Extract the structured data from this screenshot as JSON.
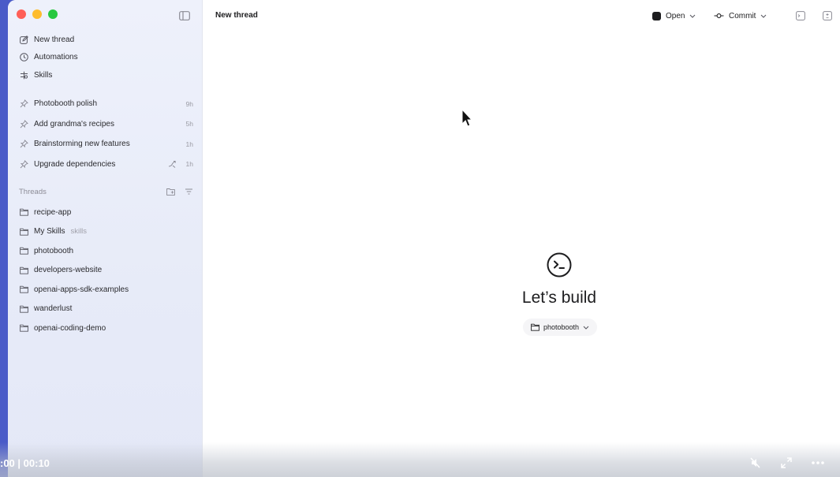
{
  "window": {
    "title": "New thread"
  },
  "sidebar": {
    "nav": [
      {
        "label": "New thread",
        "icon": "edit-icon"
      },
      {
        "label": "Automations",
        "icon": "clock-icon"
      },
      {
        "label": "Skills",
        "icon": "skills-icon"
      }
    ],
    "pinned": [
      {
        "label": "Photobooth polish",
        "time": "9h"
      },
      {
        "label": "Add grandma's recipes",
        "time": "5h"
      },
      {
        "label": "Brainstorming new features",
        "time": "1h"
      },
      {
        "label": "Upgrade dependencies",
        "time": "1h"
      }
    ],
    "threads_heading": "Threads",
    "threads": [
      {
        "label": "recipe-app",
        "sub": ""
      },
      {
        "label": "My Skills",
        "sub": "skills"
      },
      {
        "label": "photobooth",
        "sub": ""
      },
      {
        "label": "developers-website",
        "sub": ""
      },
      {
        "label": "openai-apps-sdk-examples",
        "sub": ""
      },
      {
        "label": "wanderlust",
        "sub": ""
      },
      {
        "label": "openai-coding-demo",
        "sub": ""
      }
    ]
  },
  "toolbar": {
    "open_label": "Open",
    "commit_label": "Commit"
  },
  "main": {
    "hero_title": "Let’s build",
    "project_selector": "photobooth"
  },
  "video": {
    "time": ":00 | 00:10"
  }
}
